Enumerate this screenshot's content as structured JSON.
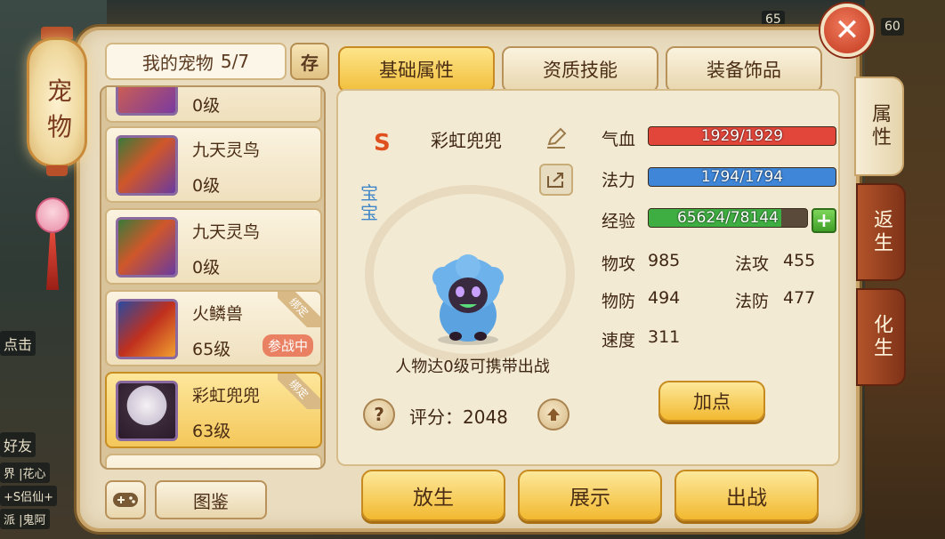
{
  "lantern": {
    "chars": [
      "宠",
      "物"
    ]
  },
  "background": {
    "chat_prefix": "点击",
    "friend": "好友",
    "chat_lines": [
      "界 |花心",
      "+S侣仙+",
      "派 |鬼阿"
    ],
    "top_num_1": "65",
    "top_num_2": "60"
  },
  "header": {
    "title": "我的宠物",
    "count": "5/7",
    "store_label": "存"
  },
  "top_tabs": [
    {
      "label": "基础属性",
      "active": true
    },
    {
      "label": "资质技能",
      "active": false
    },
    {
      "label": "装备饰品",
      "active": false
    }
  ],
  "side_tabs": [
    {
      "label": "属性",
      "active": true
    },
    {
      "label": "返生",
      "active": false
    },
    {
      "label": "化生",
      "active": false
    }
  ],
  "pets": [
    {
      "name": "",
      "level": "0级",
      "bound": false,
      "in_battle": false
    },
    {
      "name": "九天灵鸟",
      "level": "0级",
      "bound": false,
      "in_battle": false
    },
    {
      "name": "九天灵鸟",
      "level": "0级",
      "bound": false,
      "in_battle": false
    },
    {
      "name": "火鳞兽",
      "level": "65级",
      "bound": true,
      "bound_label": "绑定",
      "in_battle": true,
      "battle_label": "参战中"
    },
    {
      "name": "彩虹兜兜",
      "level": "63级",
      "bound": true,
      "bound_label": "绑定",
      "in_battle": false,
      "selected": true
    }
  ],
  "bottom_left": {
    "atlas_label": "图鉴"
  },
  "detail": {
    "grade": "S",
    "name": "彩虹兜兜",
    "baby_tag": "宝宝",
    "carry_text": "人物达0级可携带出战",
    "score_label": "评分：",
    "score": "2048",
    "help_label": "?"
  },
  "stats": {
    "hp": {
      "label": "气血",
      "current": 1929,
      "max": 1929,
      "text": "1929/1929",
      "color": "#e2463a"
    },
    "mp": {
      "label": "法力",
      "current": 1794,
      "max": 1794,
      "text": "1794/1794",
      "color": "#3f86d8"
    },
    "exp": {
      "label": "经验",
      "current": 65624,
      "max": 78144,
      "text": "65624/78144",
      "color": "#3fae42"
    },
    "phys_atk": {
      "label": "物攻",
      "value": "985"
    },
    "mag_atk": {
      "label": "法攻",
      "value": "455"
    },
    "phys_def": {
      "label": "物防",
      "value": "494"
    },
    "mag_def": {
      "label": "法防",
      "value": "477"
    },
    "speed": {
      "label": "速度",
      "value": "311"
    },
    "add_point_label": "加点"
  },
  "actions": {
    "release": "放生",
    "show": "展示",
    "battle": "出战"
  },
  "close_label": "✕"
}
